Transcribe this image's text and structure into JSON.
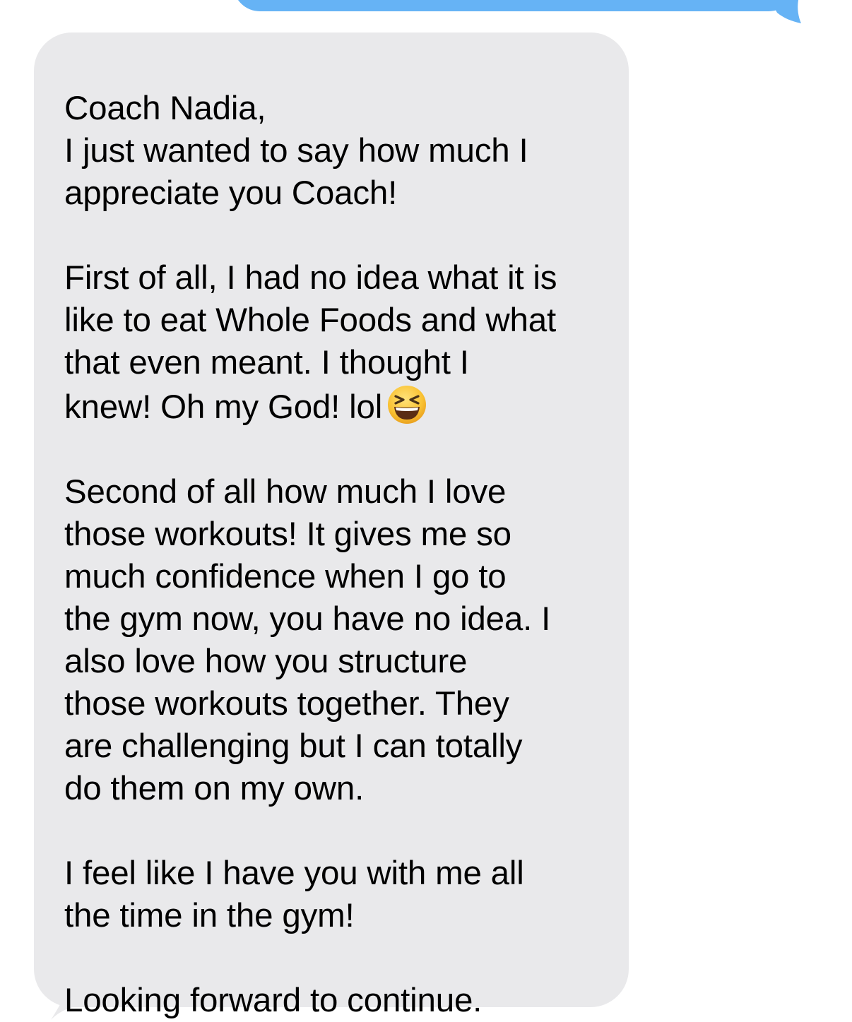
{
  "conversation": {
    "sent_message": {
      "text": "",
      "bubble_color": "#66b3f5"
    },
    "received_message": {
      "bubble_color": "#e9e9eb",
      "text_color": "#000000",
      "greeting": "Coach Nadia,",
      "p1_lines": [
        "I just wanted to say how much I",
        "appreciate you Coach!"
      ],
      "p2_lines": [
        "First of all, I had no idea what it is",
        "like to eat Whole Foods and what",
        "that even meant. I thought I",
        "knew! Oh my God! lol"
      ],
      "emoji": "laughing-squinting-face",
      "p3_lines": [
        "Second of all how much I love",
        "those workouts! It gives me so",
        "much confidence when I go to",
        "the gym now, you have no idea. I",
        "also love how you structure",
        "those workouts together. They",
        "are challenging but I can totally",
        "do them on my own."
      ],
      "p4_lines": [
        "I feel like I have you with me all",
        "the time in the gym!"
      ],
      "p5_lines": [
        "Looking forward to continue."
      ]
    }
  }
}
